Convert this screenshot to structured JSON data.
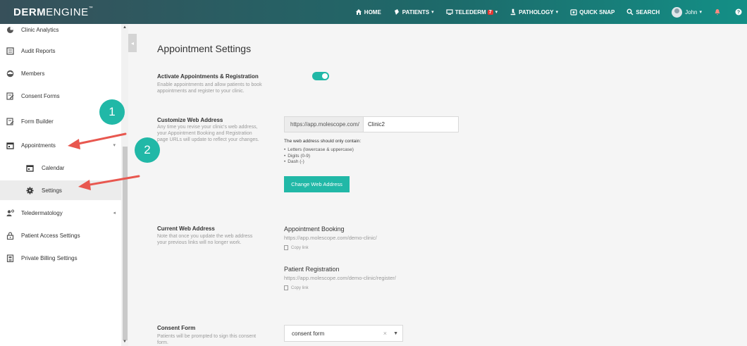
{
  "brand": {
    "bold": "DERM",
    "light": "ENGINE",
    "tm": "™"
  },
  "nav": {
    "home": "HOME",
    "patients": "PATIENTS",
    "telederm": "TELEDERM",
    "telederm_badge": "7",
    "pathology": "PATHOLOGY",
    "quick_snap": "QUICK SNAP",
    "search": "SEARCH",
    "user": "John"
  },
  "sidebar": {
    "items": [
      {
        "label": "Clinic Analytics",
        "icon": "pie-chart-icon"
      },
      {
        "label": "Audit Reports",
        "icon": "report-icon"
      },
      {
        "label": "Members",
        "icon": "members-icon"
      },
      {
        "label": "Consent Forms",
        "icon": "edit-form-icon"
      },
      {
        "label": "Form Builder",
        "icon": "form-builder-icon"
      },
      {
        "label": "Appointments",
        "icon": "calendar-icon"
      },
      {
        "label": "Calendar",
        "icon": "calendar-icon"
      },
      {
        "label": "Settings",
        "icon": "gear-icon"
      },
      {
        "label": "Teledermatology",
        "icon": "teledermatology-icon"
      },
      {
        "label": "Patient Access Settings",
        "icon": "lock-icon"
      },
      {
        "label": "Private Billing Settings",
        "icon": "billing-icon"
      }
    ]
  },
  "annotations": {
    "step1": "1",
    "step2": "2"
  },
  "page": {
    "title": "Appointment Settings"
  },
  "activate": {
    "title": "Activate Appointments & Registration",
    "desc_line1": "Enable appointments and allow patients to book",
    "desc_line2": "appointments and register to your clinic.",
    "enabled": true
  },
  "web_address": {
    "title": "Customize Web Address",
    "desc_line1": "Any time you revise your clinic's web address,",
    "desc_line2": "your Appointment Booking and Registration",
    "desc_line3": "page URLs will update to reflect your changes.",
    "prefix": "https://app.molescope.com/",
    "value": "Clinic2",
    "rules_title": "The web address should only contain:",
    "rules": [
      "Letters (lowercase & uppercase)",
      "Digits (0-9)",
      "Dash (-)"
    ],
    "button": "Change Web Address"
  },
  "current_address": {
    "title": "Current Web Address",
    "desc_line1": "Note that once you update the web address",
    "desc_line2": "your previous links will no longer work.",
    "booking_label": "Appointment Booking",
    "booking_url": "https://app.molescope.com/demo-clinic/",
    "registration_label": "Patient Registration",
    "registration_url": "https://app.molescope.com/demo-clinic/register/",
    "copy_link": "Copy link"
  },
  "consent": {
    "title": "Consent Form",
    "desc_line1": "Patients will be prompted to sign this consent",
    "desc_line2": "form.",
    "selected": "consent form"
  },
  "colors": {
    "accent": "#21b8a7",
    "arrow": "#e8574f"
  }
}
